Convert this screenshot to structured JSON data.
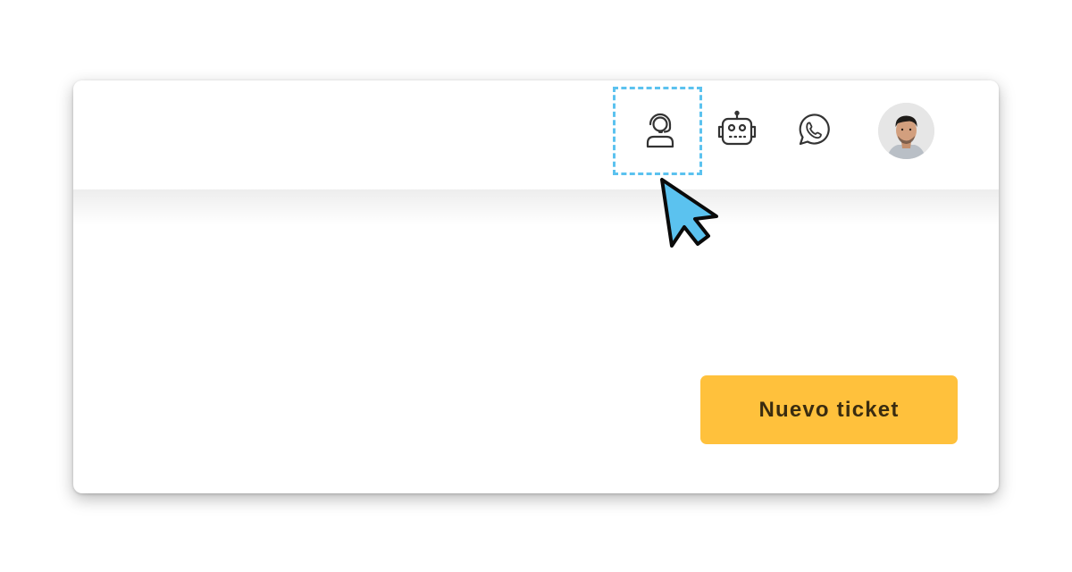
{
  "header": {
    "icons": {
      "agent": "headset-agent-icon",
      "bot": "robot-icon",
      "whatsapp": "whatsapp-icon"
    },
    "avatar": "user-avatar"
  },
  "actions": {
    "new_ticket_label": "Nuevo ticket"
  },
  "colors": {
    "accent_button": "#ffc13c",
    "highlight": "#5bc2ef",
    "cursor_fill": "#5bc2ef",
    "icon_stroke": "#333333"
  }
}
